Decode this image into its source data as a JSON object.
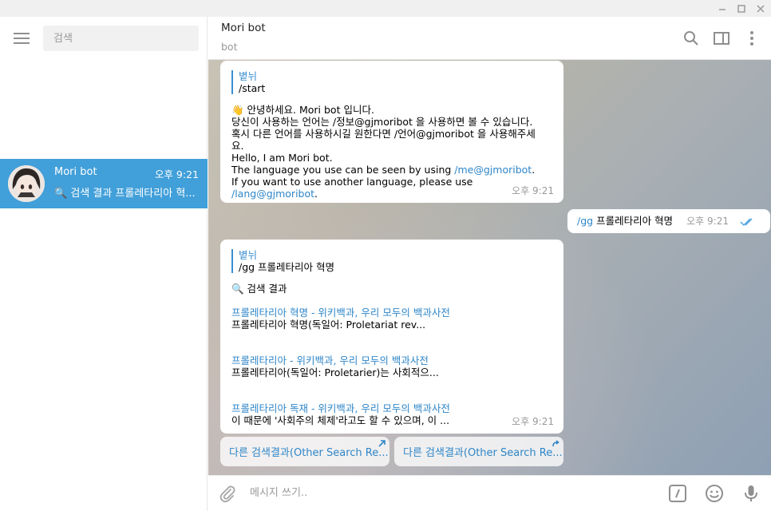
{
  "window": {
    "minimize": "—",
    "maximize": "☐",
    "close": "✕"
  },
  "sidebar": {
    "search_placeholder": "검색",
    "chats": [
      {
        "name": "Mori bot",
        "time": "오후 9:21",
        "preview": "🔍 검색 결과  프롤레타리아 혁..."
      }
    ]
  },
  "header": {
    "title": "Mori bot",
    "status": "bot"
  },
  "messages": {
    "m1": {
      "reply_author": "볕뉘",
      "reply_text": "/start",
      "lines": [
        "👋 안녕하세요. Mori bot 입니다.",
        "당신이 사용하는 언어는 /정보@gjmoribot 을 사용하면 볼 수 있습니다.",
        "혹시 다른 언어를 사용하시길 원한다면 /언어@gjmoribot 을 사용해주세",
        "요.",
        "Hello, I am Mori bot."
      ],
      "l6_pre": "The language you use can be seen by using ",
      "l6_link": "/me@gjmoribot",
      "l6_post": ".",
      "l7_pre": "If you want to use another language, please use ",
      "l7_link": "/lang@gjmoribot",
      "l7_post": ".",
      "time": "오후 9:21"
    },
    "m2": {
      "cmd": "/gg",
      "text": " 프롤레타리아 혁명",
      "time": "오후 9:21"
    },
    "m3": {
      "reply_author": "볕뉘",
      "reply_text": "/gg 프롤레타리아 혁명",
      "heading": "🔍 검색 결과",
      "results": [
        {
          "title": "프롤레타리아 혁명 - 위키백과, 우리 모두의 백과사전",
          "snippet": "프롤레타리아 혁명(독일어: Proletariat rev..."
        },
        {
          "title": "프롤레타리아 - 위키백과, 우리 모두의 백과사전",
          "snippet": "프롤레타리아(독일어: Proletarier)는 사회적으..."
        },
        {
          "title": "프롤레타리아 독재 - 위키백과, 우리 모두의 백과사전",
          "snippet": "이 때문에 '사회주의 체제'라고도 할 수 있으며, 이 ..."
        }
      ],
      "time": "오후 9:21"
    }
  },
  "inline_buttons": [
    "다른 검색결과(Other Search Re...",
    "다른 검색결과(Other Search Re..."
  ],
  "composer": {
    "placeholder": "메시지 쓰기.."
  },
  "colors": {
    "accent": "#419fd9",
    "link": "#2e86c8",
    "read_check": "#4fa3e0"
  }
}
